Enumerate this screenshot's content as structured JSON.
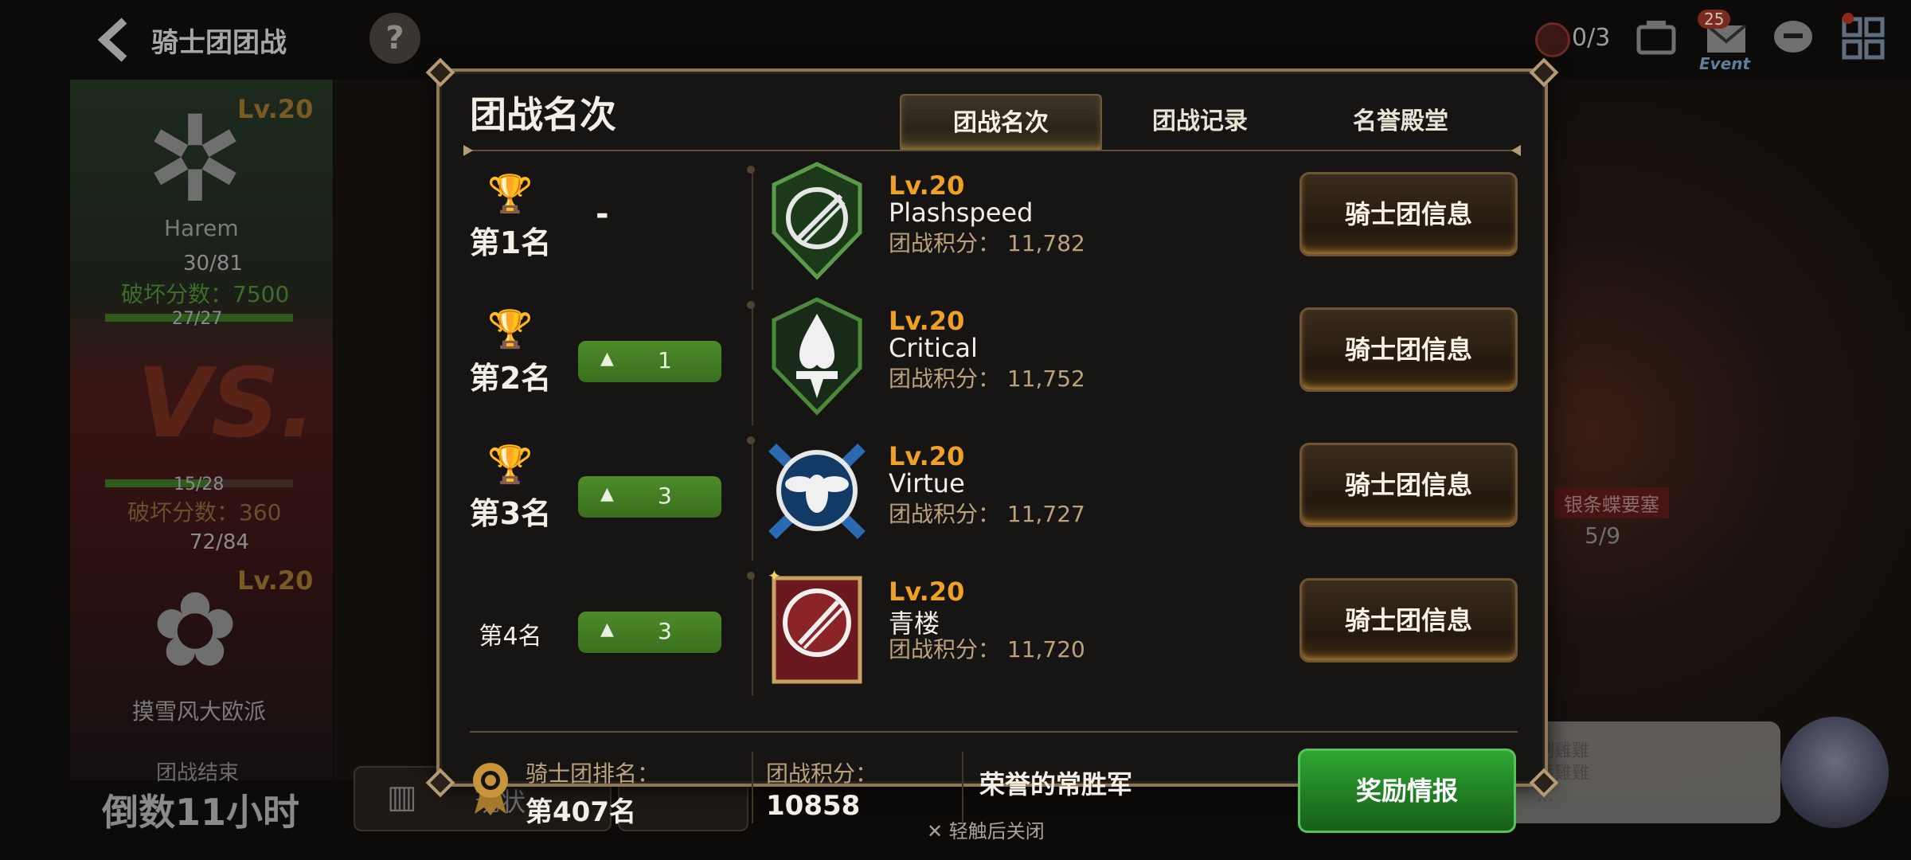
{
  "topbar": {
    "back_icon": "chevron-left-icon",
    "title": "骑士团团战",
    "help_label": "?",
    "stamina": "0/3",
    "mail_badge": "25",
    "event_label": "Event"
  },
  "background": {
    "guild_a": {
      "level": "Lv.20",
      "name": "Harem",
      "stamina": "30/81",
      "destruction_score": "破坏分数：7500",
      "progress": "27/27",
      "progress_fraction": 1.0
    },
    "vs_label": "VS.",
    "guild_b": {
      "level": "Lv.20",
      "name": "摸雪风大欧派",
      "stamina": "72/84",
      "destruction_score": "破坏分数：360",
      "progress": "15/28",
      "progress_fraction": 0.536
    },
    "war_end_label": "团战结束",
    "countdown": "倒数11小时",
    "status_button": "现状",
    "fortress_label": "银条蝶要塞",
    "fortress_count": "5/9",
    "chat_lines": [
      "制雞雞",
      "添雞雞",
      "..."
    ],
    "close_hint": "轻触后关闭"
  },
  "modal": {
    "title": "团战名次",
    "tabs": [
      {
        "label": "团战名次",
        "active": true
      },
      {
        "label": "团战记录",
        "active": false
      },
      {
        "label": "名誉殿堂",
        "active": false
      }
    ],
    "rows": [
      {
        "rank": "第1名",
        "change": "-",
        "change_up": null,
        "level": "Lv.20",
        "guild": "Plashspeed",
        "score": "团战积分：  11,782",
        "button": "骑士团信息",
        "emblem_color": "#2f6b2a"
      },
      {
        "rank": "第2名",
        "change": "",
        "change_up": "1",
        "level": "Lv.20",
        "guild": "Critical",
        "score": "团战积分：  11,752",
        "button": "骑士团信息",
        "emblem_color": "#2a5a24"
      },
      {
        "rank": "第3名",
        "change": "",
        "change_up": "3",
        "level": "Lv.20",
        "guild": "Virtue",
        "score": "团战积分：  11,727",
        "button": "骑士团信息",
        "emblem_color": "#1f5a8a"
      },
      {
        "rank": "第4名",
        "change": "",
        "change_up": "3",
        "level": "Lv.20",
        "guild": "青楼",
        "score": "团战积分：  11,720",
        "button": "骑士团信息",
        "emblem_color": "#7a1e22"
      }
    ],
    "footer": {
      "rank_label": "骑士团排名：",
      "rank_value": "第407名",
      "score_label": "团战积分：",
      "score_value": "10858",
      "honor_title": "荣誉的常胜军",
      "reward_button": "奖励情报"
    }
  }
}
